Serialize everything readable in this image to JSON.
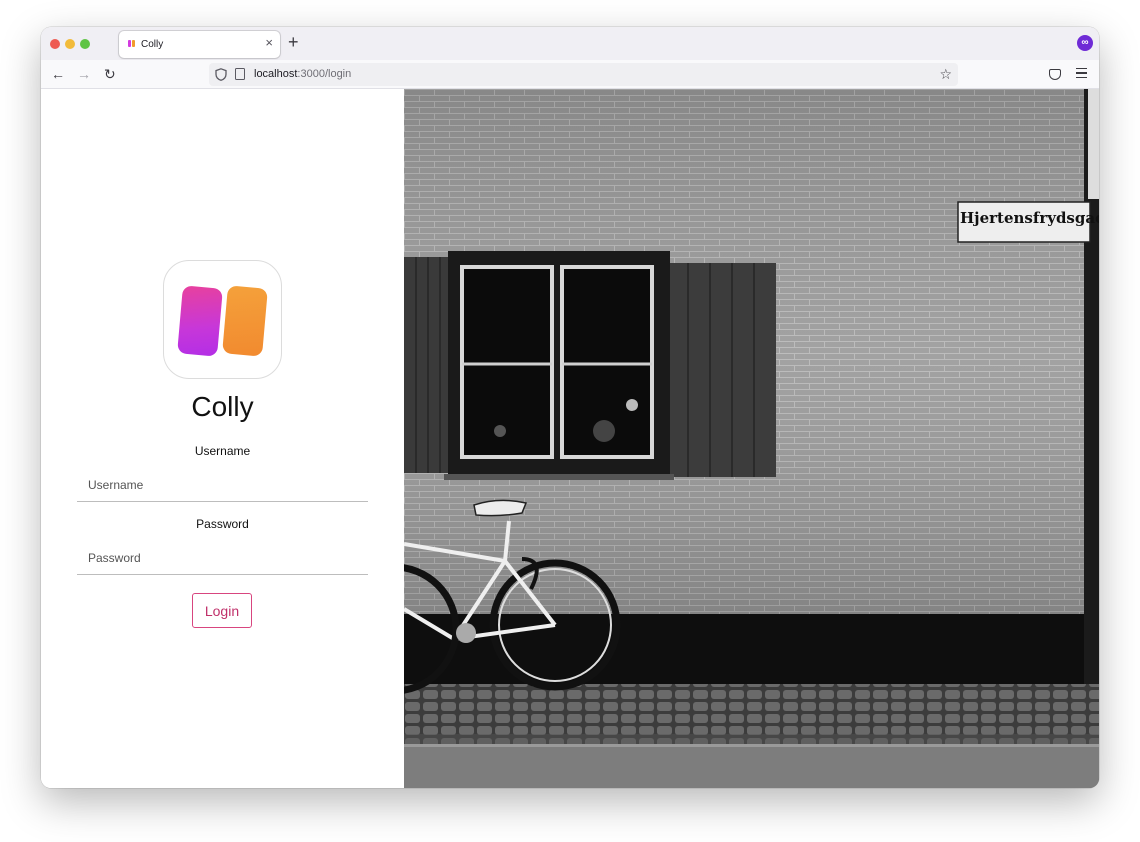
{
  "browser": {
    "tab_title": "Colly",
    "tab_close": "×",
    "new_tab": "+",
    "back": "←",
    "forward": "→",
    "reload": "↻",
    "url_host": "localhost",
    "url_path": ":3000/login",
    "bookmark": "☆",
    "extension_icon": "∞"
  },
  "login": {
    "app_name": "Colly",
    "username_label": "Username",
    "username_placeholder": "Username",
    "password_label": "Password",
    "password_placeholder": "Password",
    "login_button": "Login"
  },
  "photo": {
    "street_sign": "Hjertensfrydsgade"
  },
  "colors": {
    "accent": "#c0306a",
    "icon_pink": "#d33be0",
    "icon_orange": "#f29a2c"
  }
}
